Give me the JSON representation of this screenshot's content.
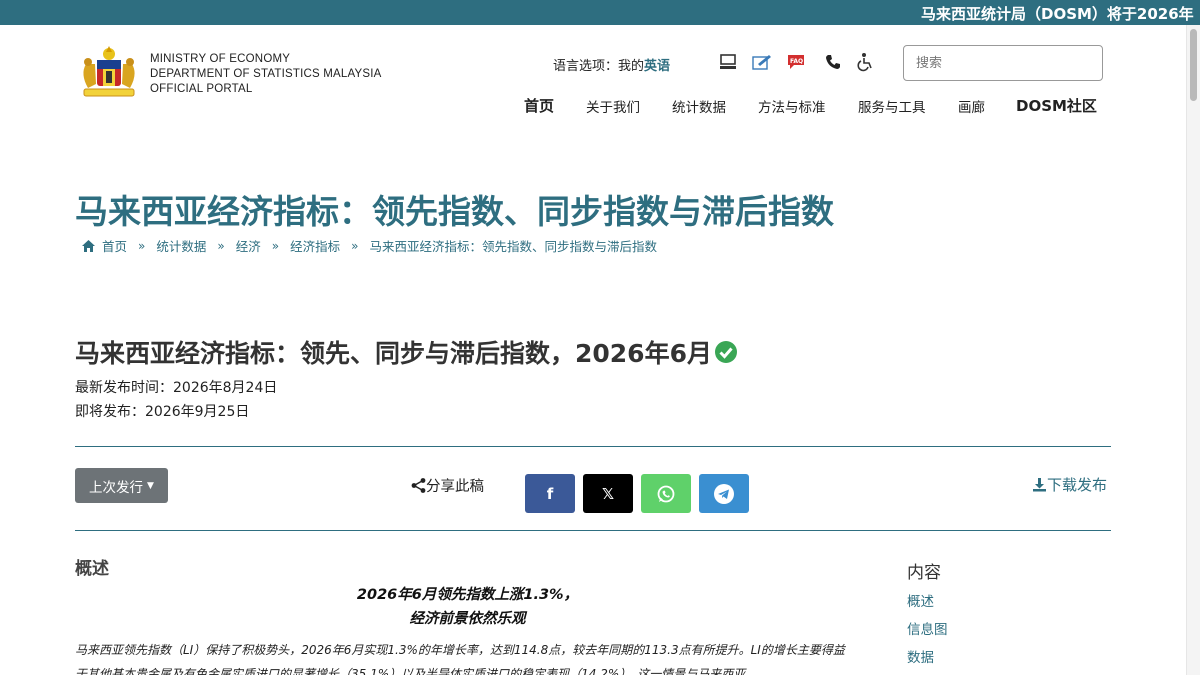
{
  "ticker": {
    "text": "马来西亚统计局（DOSM）将于2026年"
  },
  "header": {
    "logo_lines": [
      "MINISTRY OF ECONOMY",
      "DEPARTMENT OF STATISTICS MALAYSIA",
      "OFFICIAL PORTAL"
    ],
    "lang_label": "语言选项：我的",
    "lang_value": "英语",
    "search_placeholder": "搜索",
    "tool_icons": [
      "computer-icon",
      "feedback-icon",
      "faq-icon",
      "phone-icon",
      "accessibility-icon"
    ]
  },
  "nav": {
    "items": [
      "首页",
      "关于我们",
      "统计数据",
      "方法与标准",
      "服务与工具",
      "画廊",
      "DOSM社区"
    ]
  },
  "page": {
    "title": "马来西亚经济指标：领先指数、同步指数与滞后指数",
    "breadcrumb": [
      "首页",
      "统计数据",
      "经济",
      "经济指标",
      "马来西亚经济指标：领先指数、同步指数与滞后指数"
    ]
  },
  "release": {
    "title": "马来西亚经济指标：领先、同步与滞后指数，2026年6月",
    "latest": "最新发布时间：2026年8月24日",
    "upcoming": "即将发布：2026年9月25日"
  },
  "actions": {
    "prev_release": "上次发行",
    "share": "分享此稿",
    "download": "下载发布",
    "social": [
      {
        "name": "facebook",
        "glyph": "f",
        "color": "#3b5998"
      },
      {
        "name": "x",
        "glyph": "𝕏",
        "color": "#000000"
      },
      {
        "name": "whatsapp",
        "glyph": "✆",
        "color": "#5fd16a"
      },
      {
        "name": "telegram",
        "glyph": "➤",
        "color": "#3a8fd1"
      }
    ]
  },
  "overview": {
    "title": "概述",
    "headline1": "2026年6月领先指数上涨1.3%，",
    "headline2": "经济前景依然乐观",
    "paragraph": "马来西亚领先指数（LI）保持了积极势头，2026年6月实现1.3%的年增长率，达到114.8点，较去年同期的113.3点有所提升。LI的增长主要得益于其他基本贵金属及有色金属实质进口的显著增长（35.1%）以及半导体实质进口的稳定表现（14.2%）。这一情景与马来西亚"
  },
  "toc": {
    "title": "内容",
    "items": [
      "概述",
      "信息图",
      "数据"
    ]
  },
  "colors": {
    "brand": "#2e6e80",
    "verified": "#3aa655"
  }
}
